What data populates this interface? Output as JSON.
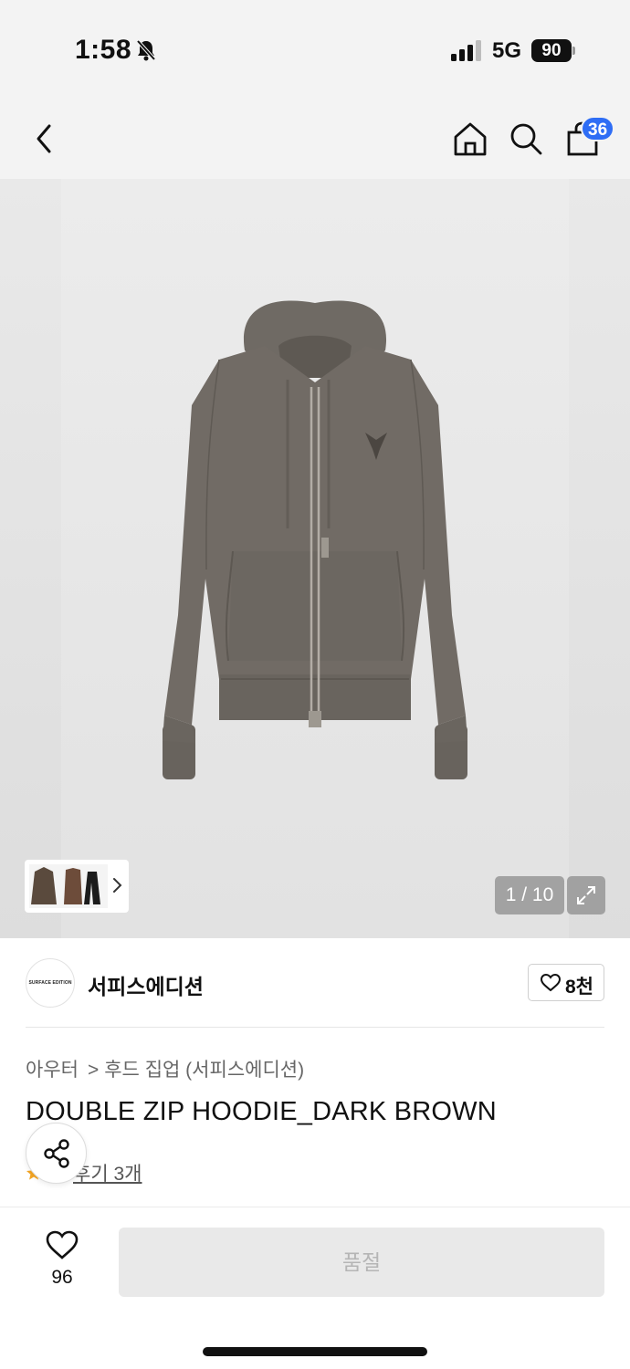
{
  "status_bar": {
    "time": "1:58",
    "network": "5G",
    "battery": "90"
  },
  "header": {
    "cart_count": "36",
    "icons": [
      "back-icon",
      "home-icon",
      "search-icon",
      "shopping-bag-icon"
    ]
  },
  "gallery": {
    "counter": "1 / 10",
    "icons": [
      "chevron-right-icon",
      "expand-icon"
    ]
  },
  "brand": {
    "logo_text": "SURFACE EDITION",
    "name": "서피스에디션",
    "like_count": "8천"
  },
  "product": {
    "breadcrumb": [
      "아우터",
      "후드 집업 (서피스에디션)"
    ],
    "breadcrumb_separator": ">",
    "title": "DOUBLE ZIP HOODIE_DARK BROWN",
    "review_link": "후기 3개"
  },
  "bottom_bar": {
    "wish_count": "96",
    "buy_button": "품절"
  },
  "colors": {
    "accent_badge": "#2e6df5",
    "background_header": "#f3f3f3",
    "disabled_button": "#e9e9e9",
    "star": "#f5a623"
  }
}
